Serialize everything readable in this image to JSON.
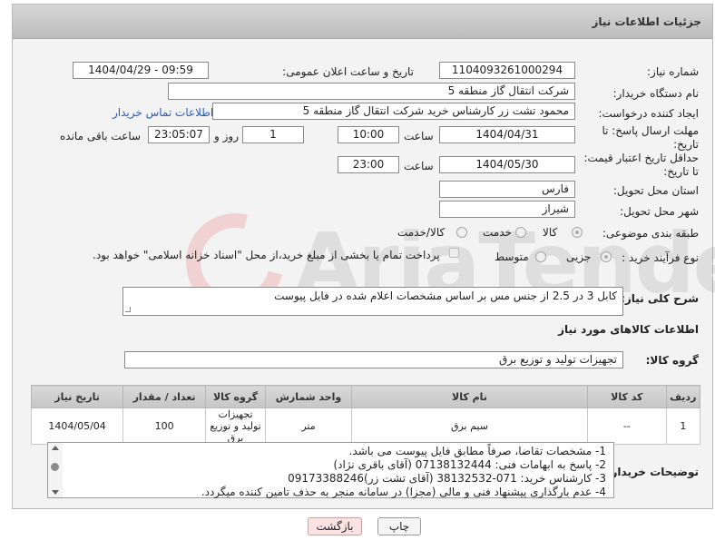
{
  "header": {
    "title": "جزئیات اطلاعات نیاز"
  },
  "form": {
    "need_number_label": "شماره نیاز:",
    "need_number": "1104093261000294",
    "announce_label": "تاریخ و ساعت اعلان عمومی:",
    "announce_value": "1404/04/29 - 09:59",
    "buyer_org_label": "نام دستگاه خریدار:",
    "buyer_org": "شرکت انتقال گاز منطقه 5",
    "requester_label": "ایجاد کننده درخواست:",
    "requester": "محمود تشت زر کارشناس خرید شرکت انتقال گاز منطقه 5",
    "buyer_contact_link": "اطلاعات تماس خریدار",
    "deadline_label": "مهلت ارسال پاسخ: تا تاریخ:",
    "deadline_date": "1404/04/31",
    "time_label": "ساعت",
    "deadline_time": "10:00",
    "days_value": "1",
    "days_label": "روز و",
    "remaining_value": "23:05:07",
    "remaining_label": "ساعت باقی مانده",
    "price_valid_label": "حداقل تاریخ اعتبار قیمت: تا تاریخ:",
    "price_valid_date": "1404/05/30",
    "price_valid_time": "23:00",
    "province_label": "استان محل تحویل:",
    "province": "فارس",
    "city_label": "شهر محل تحویل:",
    "city": "شیراز",
    "category_label": "طبقه بندی موضوعی:",
    "category_options": [
      "کالا",
      "خدمت",
      "کالا/خدمت"
    ],
    "process_label": "نوع فرآیند خرید :",
    "process_options": [
      "جزیی",
      "متوسط"
    ],
    "payment_note": "پرداخت تمام یا بخشی از مبلغ خرید،از محل \"اسناد خزانه اسلامی\" خواهد بود.",
    "description_label": "شرح کلی نیاز:",
    "description": "کابل 3 در 2.5 از جنس مس بر اساس مشخصات اعلام شده در فایل پیوست",
    "goods_info_title": "اطلاعات کالاهای مورد نیاز",
    "goods_group_label": "گروه کالا:",
    "goods_group": "تجهیزات تولید و توزیع برق"
  },
  "table": {
    "headers": [
      "ردیف",
      "کد کالا",
      "نام کالا",
      "واحد شمارش",
      "گروه کالا",
      "تعداد / مقدار",
      "تاریخ نیاز"
    ],
    "rows": [
      [
        "1",
        "--",
        "سیم برق",
        "متر",
        "تجهیزات تولید و توزیع برق",
        "100",
        "1404/05/04"
      ]
    ]
  },
  "notes": {
    "label": "توضیحات خریدار:",
    "lines": [
      "1-  مشخصات تقاضا، صرفاً مطابق فایل پیوست می باشد.",
      "2- پاسخ به ابهامات فنی: 07138132444 (آقای باقری نژاد)",
      "3- کارشناس خرید: 071-38132532 (آقای تشت زر)09173388246",
      "4- عدم بارگذاری پیشنهاد فنی و مالی (مجزا) در سامانه منجر به حذف تامین کننده میگردد."
    ]
  },
  "buttons": {
    "print": "چاپ",
    "back": "بازگشت"
  },
  "watermark": {
    "text": "AriaTender.net"
  },
  "colors": {
    "link": "#2a5bb8",
    "header_bg": "#c9c9c9",
    "back_button": "#fbe3e3"
  }
}
